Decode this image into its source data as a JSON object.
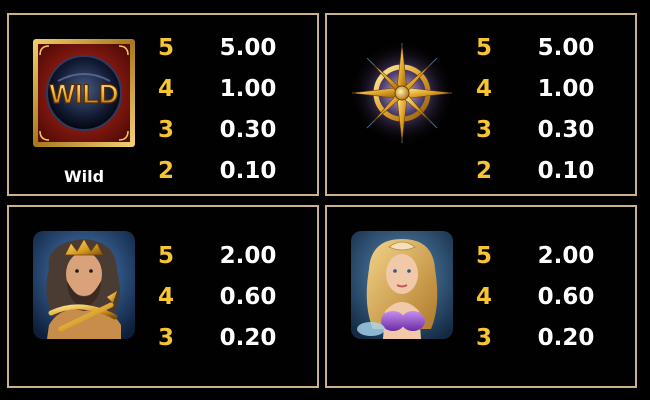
{
  "paytable": {
    "panels": [
      {
        "symbol": "wild",
        "icon": "wild-symbol-icon",
        "caption": "Wild",
        "rows": [
          {
            "count": "5",
            "value": "5.00"
          },
          {
            "count": "4",
            "value": "1.00"
          },
          {
            "count": "3",
            "value": "0.30"
          },
          {
            "count": "2",
            "value": "0.10"
          }
        ]
      },
      {
        "symbol": "compass",
        "icon": "compass-symbol-icon",
        "rows": [
          {
            "count": "5",
            "value": "5.00"
          },
          {
            "count": "4",
            "value": "1.00"
          },
          {
            "count": "3",
            "value": "0.30"
          },
          {
            "count": "2",
            "value": "0.10"
          }
        ]
      },
      {
        "symbol": "sea-king",
        "icon": "sea-king-symbol-icon",
        "rows": [
          {
            "count": "5",
            "value": "2.00"
          },
          {
            "count": "4",
            "value": "0.60"
          },
          {
            "count": "3",
            "value": "0.20"
          }
        ]
      },
      {
        "symbol": "mermaid",
        "icon": "mermaid-symbol-icon",
        "rows": [
          {
            "count": "5",
            "value": "2.00"
          },
          {
            "count": "4",
            "value": "0.60"
          },
          {
            "count": "3",
            "value": "0.20"
          }
        ]
      }
    ]
  },
  "wild_label": "WILD",
  "colors": {
    "panel_border": "#c9b287",
    "count_text": "#f7c531",
    "value_text": "#ffffff",
    "background": "#000000"
  }
}
